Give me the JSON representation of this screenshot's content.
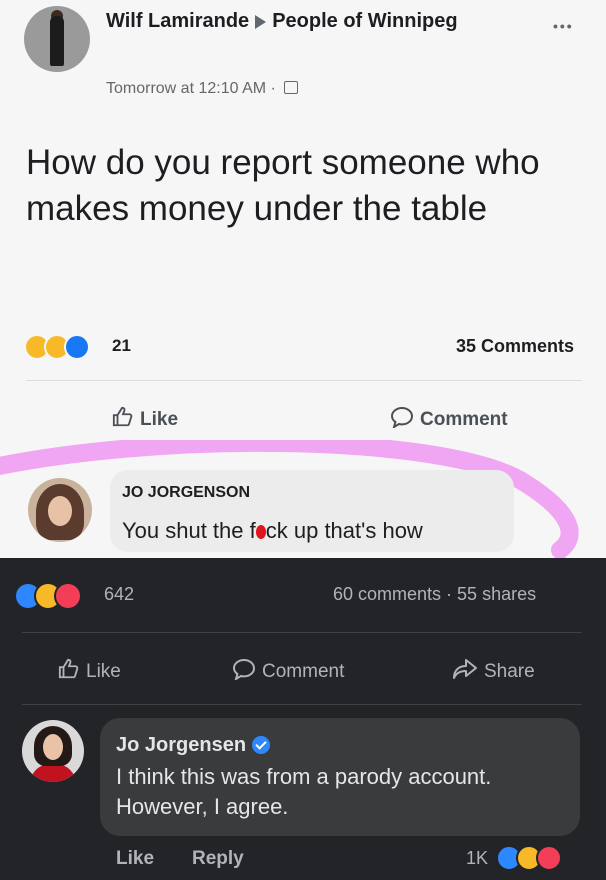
{
  "post": {
    "author": "Wilf Lamirande",
    "group": "People of Winnipeg",
    "timestamp": "Tomorrow at 12:10 AM",
    "separator": "·",
    "text": "How do you report someone who makes money under the table",
    "reaction_count": "21",
    "comments_count": "35 Comments",
    "like_label": "Like",
    "comment_label": "Comment",
    "reply": {
      "author": "JO JORGENSON",
      "text_before": "You shut the f",
      "text_after": "ck up that's how"
    }
  },
  "repost": {
    "reaction_count": "642",
    "stats": "60 comments · 55 shares",
    "like_label": "Like",
    "comment_label": "Comment",
    "share_label": "Share",
    "comment": {
      "author": "Jo Jorgensen",
      "text": "I think this was from a parody account. However, I agree.",
      "like_label": "Like",
      "reply_label": "Reply",
      "reaction_count": "1K"
    }
  },
  "colors": {
    "highlight": "#f0a6f2",
    "link_blue": "#2d88ff",
    "dark_bg": "#232427"
  },
  "icons": [
    "more-icon",
    "globe-icon",
    "like-thumb-icon",
    "comment-bubble-icon",
    "share-arrow-icon",
    "verified-badge-icon"
  ]
}
